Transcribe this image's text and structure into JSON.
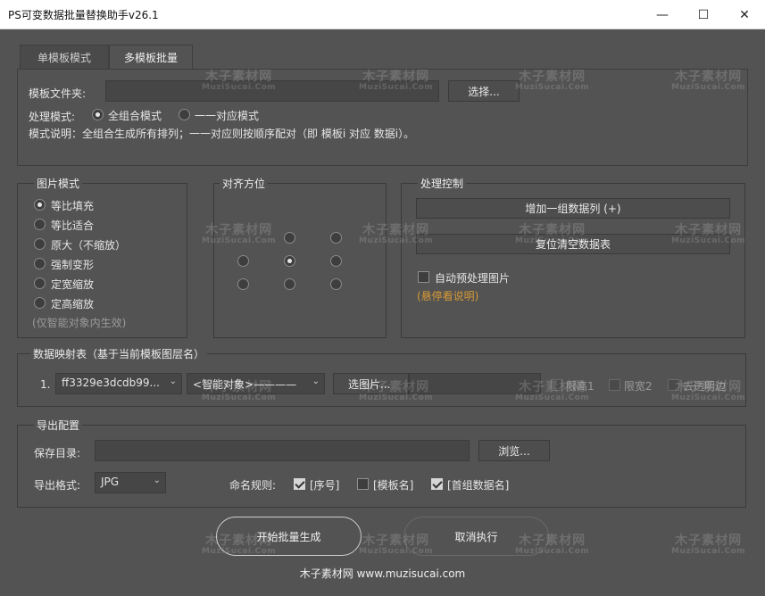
{
  "window": {
    "title": "PS可变数据批量替换助手v26.1",
    "minimize": "—",
    "maximize": "☐",
    "close": "✕"
  },
  "tabs": [
    {
      "label": "单模板模式",
      "active": false
    },
    {
      "label": "多模板批量",
      "active": true
    }
  ],
  "template": {
    "folder_label": "模板文件夹:",
    "folder_value": "",
    "choose_button": "选择...",
    "mode_label": "处理模式:",
    "mode_options": [
      "全组合模式",
      "一一对应模式"
    ],
    "mode_selected": 0,
    "desc": "模式说明：全组合生成所有排列；一一对应则按顺序配对（即 模板i 对应 数据i）。"
  },
  "image_mode": {
    "title": "图片模式",
    "options": [
      "等比填充",
      "等比适合",
      "原大（不缩放）",
      "强制变形",
      "定宽缩放",
      "定高缩放"
    ],
    "selected": 0,
    "note": "(仅智能对象内生效)"
  },
  "alignment": {
    "title": "对齐方位",
    "selected": 4
  },
  "control": {
    "title": "处理控制",
    "add_button": "增加一组数据列 (+)",
    "reset_button": "复位清空数据表",
    "auto_preprocess_label": "自动预处理图片",
    "auto_preprocess_checked": false,
    "hover_hint": "(悬停看说明)"
  },
  "mapping": {
    "title": "数据映射表（基于当前模板图层名）",
    "rows": [
      {
        "index": "1.",
        "layer": "ff3329e3dcdb99...",
        "type": "<智能对象>————",
        "pick_button": "选图片...",
        "value": "",
        "limit_height": "限高1",
        "limit_width": "限宽2",
        "trim": "去透明边"
      }
    ]
  },
  "export": {
    "title": "导出配置",
    "save_label": "保存目录:",
    "save_value": "",
    "browse_button": "浏览...",
    "format_label": "导出格式:",
    "format_value": "JPG",
    "naming_label": "命名规则:",
    "naming_options": [
      {
        "label": "[序号]",
        "checked": true
      },
      {
        "label": "[模板名]",
        "checked": false
      },
      {
        "label": "[首组数据名]",
        "checked": true
      }
    ]
  },
  "actions": {
    "start": "开始批量生成",
    "cancel": "取消执行"
  },
  "footer": "木子素材网 www.muzisucai.com",
  "watermark": {
    "big": "木子素材网",
    "small": "MuziSucai.Com"
  }
}
